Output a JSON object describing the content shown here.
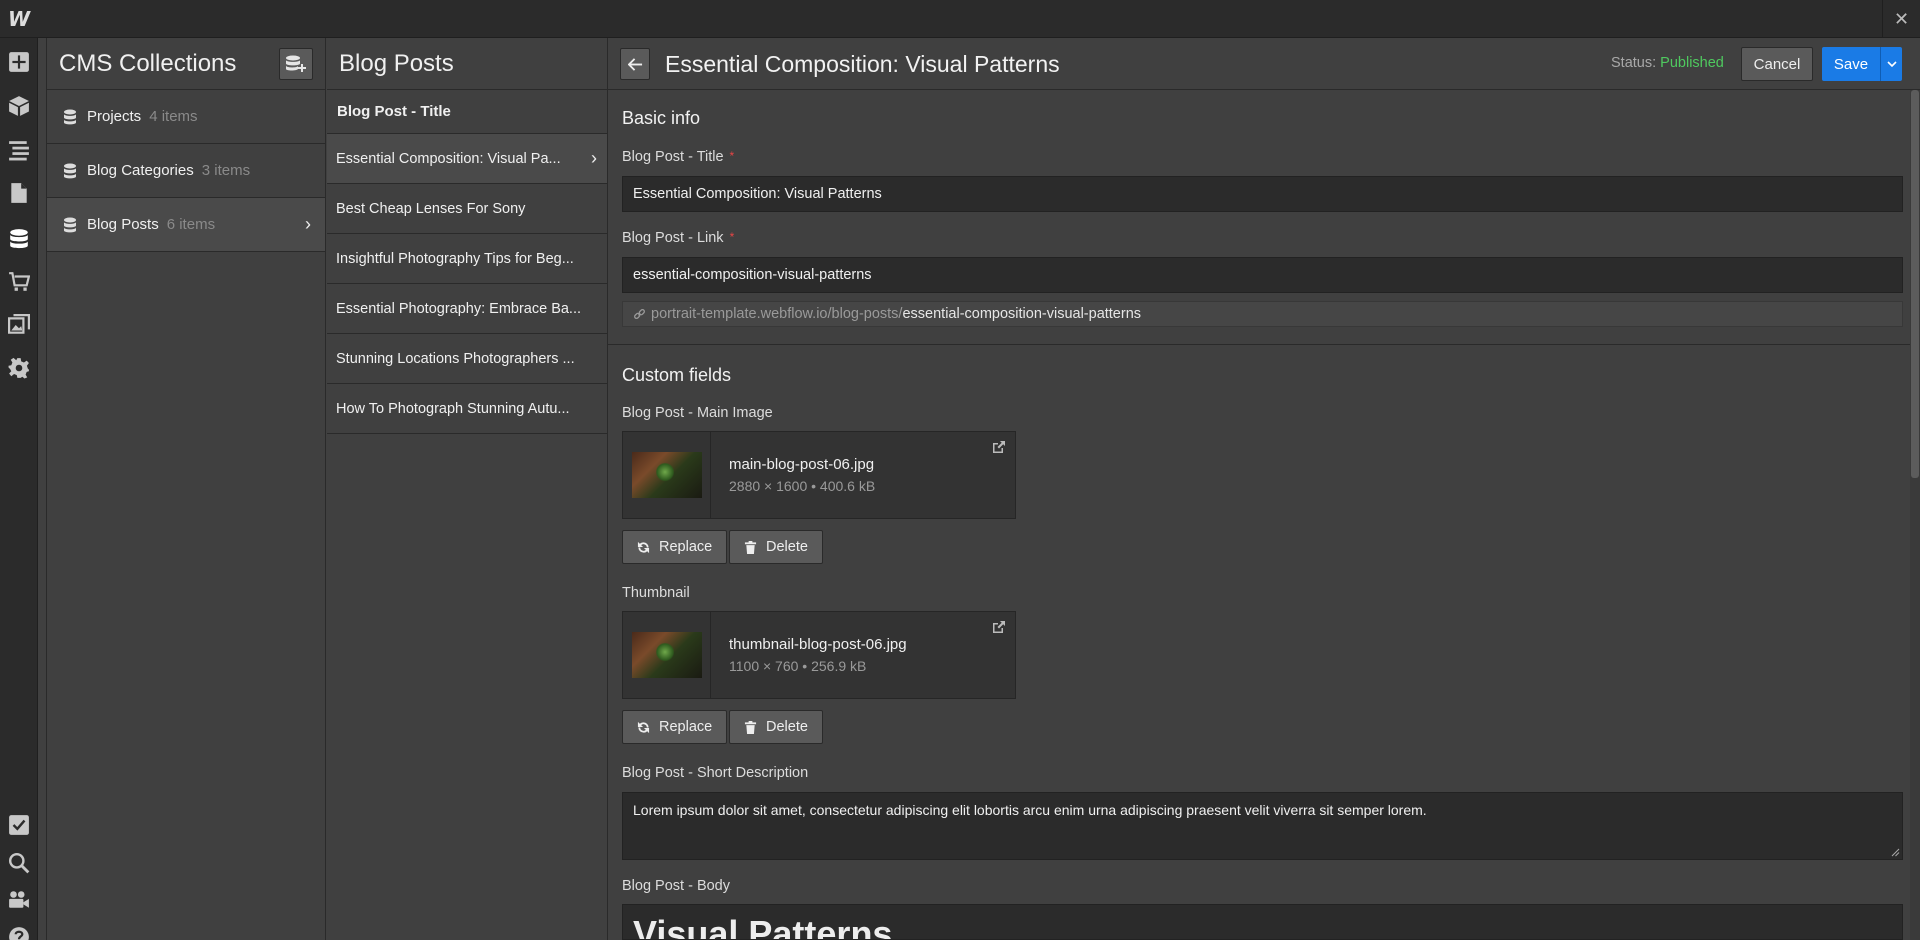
{
  "topbar": {
    "logo": "W",
    "close_glyph": "✕"
  },
  "leftbar": {
    "icons": [
      "add-icon",
      "box-icon",
      "navigator-icon",
      "pages-icon",
      "cms-icon",
      "ecommerce-icon",
      "assets-icon",
      "settings-icon",
      "tasks-icon",
      "search-icon",
      "video-icon",
      "help-icon"
    ]
  },
  "collections": {
    "title": "CMS Collections",
    "items": [
      {
        "name": "Projects",
        "count": "4 items"
      },
      {
        "name": "Blog Categories",
        "count": "3 items"
      },
      {
        "name": "Blog Posts",
        "count": "6 items"
      }
    ]
  },
  "posts": {
    "title": "Blog Posts",
    "column_header": "Blog Post - Title",
    "items": [
      "Essential Composition: Visual Pa...",
      "Best Cheap Lenses For Sony",
      "Insightful Photography Tips for Beg...",
      "Essential Photography: Embrace Ba...",
      "Stunning Locations Photographers ...",
      "How To Photograph Stunning Autu..."
    ]
  },
  "editor": {
    "title": "Essential Composition: Visual Patterns",
    "status_label": "Status:",
    "status_value": "Published",
    "cancel_label": "Cancel",
    "save_label": "Save",
    "basic_info": {
      "heading": "Basic info",
      "title_label": "Blog Post - Title",
      "title_value": "Essential Composition: Visual Patterns",
      "link_label": "Blog Post - Link",
      "link_value": "essential-composition-visual-patterns",
      "link_domain": "portrait-template.webflow.io/blog-posts/",
      "link_slug": "essential-composition-visual-patterns",
      "required_mark": "*"
    },
    "custom_fields": {
      "heading": "Custom fields",
      "main_image": {
        "label": "Blog Post - Main Image",
        "file": "main-blog-post-06.jpg",
        "meta": "2880 × 1600 • 400.6 kB"
      },
      "thumbnail": {
        "label": "Thumbnail",
        "file": "thumbnail-blog-post-06.jpg",
        "meta": "1100 × 760 • 256.9 kB"
      },
      "replace_label": "Replace",
      "delete_label": "Delete",
      "short_desc_label": "Blog Post - Short Description",
      "short_desc_value": "Lorem ipsum dolor sit amet, consectetur adipiscing elit lobortis arcu enim urna adipiscing praesent velit viverra sit semper lorem.",
      "body_label": "Blog Post - Body",
      "body_heading": "Visual Patterns"
    }
  },
  "colors": {
    "accent": "#1a7be6",
    "published": "#4fc95f",
    "required": "#e84545"
  }
}
